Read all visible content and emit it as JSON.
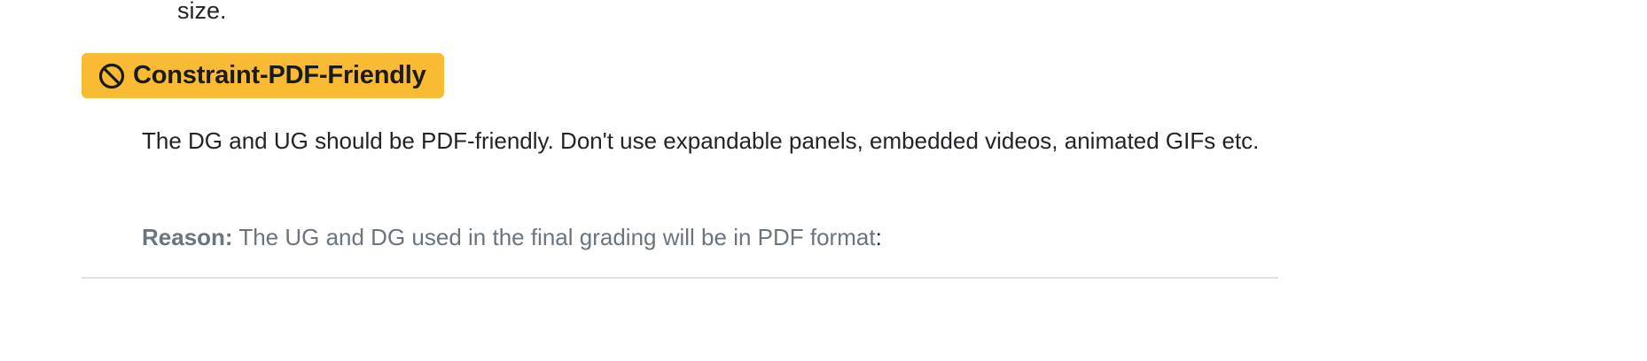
{
  "previous": {
    "text": "size."
  },
  "constraint": {
    "icon": "prohibited-icon",
    "title": "Constraint-PDF-Friendly",
    "badge_color": "#f9bb34",
    "description": "The DG and UG should be PDF-friendly. Don't use expandable panels, embedded videos, animated GIFs etc.",
    "reason_label": "Reason:",
    "reason_text": " The UG and DG used in the final grading will be in PDF format",
    "reason_suffix": ":"
  }
}
